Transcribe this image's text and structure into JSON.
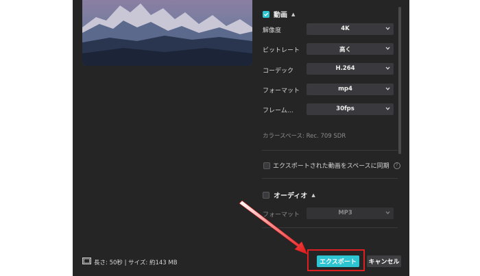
{
  "video_section": {
    "title": "動画",
    "checked": true
  },
  "settings": [
    {
      "label": "解像度",
      "value": "4K"
    },
    {
      "label": "ビットレート",
      "value": "高く"
    },
    {
      "label": "コーデック",
      "value": "H.264"
    },
    {
      "label": "フォーマット",
      "value": "mp4"
    },
    {
      "label": "フレーム…",
      "value": "30fps"
    }
  ],
  "color_space": "カラースペース: Rec. 709 SDR",
  "sync_option": {
    "label": "エクスポートされた動画をスペースに同期",
    "checked": false
  },
  "audio_section": {
    "title": "オーディオ",
    "checked": false
  },
  "audio_format": {
    "label": "フォーマット",
    "value": "MP3"
  },
  "footer": {
    "info": "長さ: 50秒 | サイズ: 約143 MB"
  },
  "buttons": {
    "export": "エクスポート",
    "cancel": "キャンセル"
  },
  "colors": {
    "accent": "#2ec5d3",
    "dialog_bg": "#252526",
    "highlight_outline": "#e02020"
  }
}
